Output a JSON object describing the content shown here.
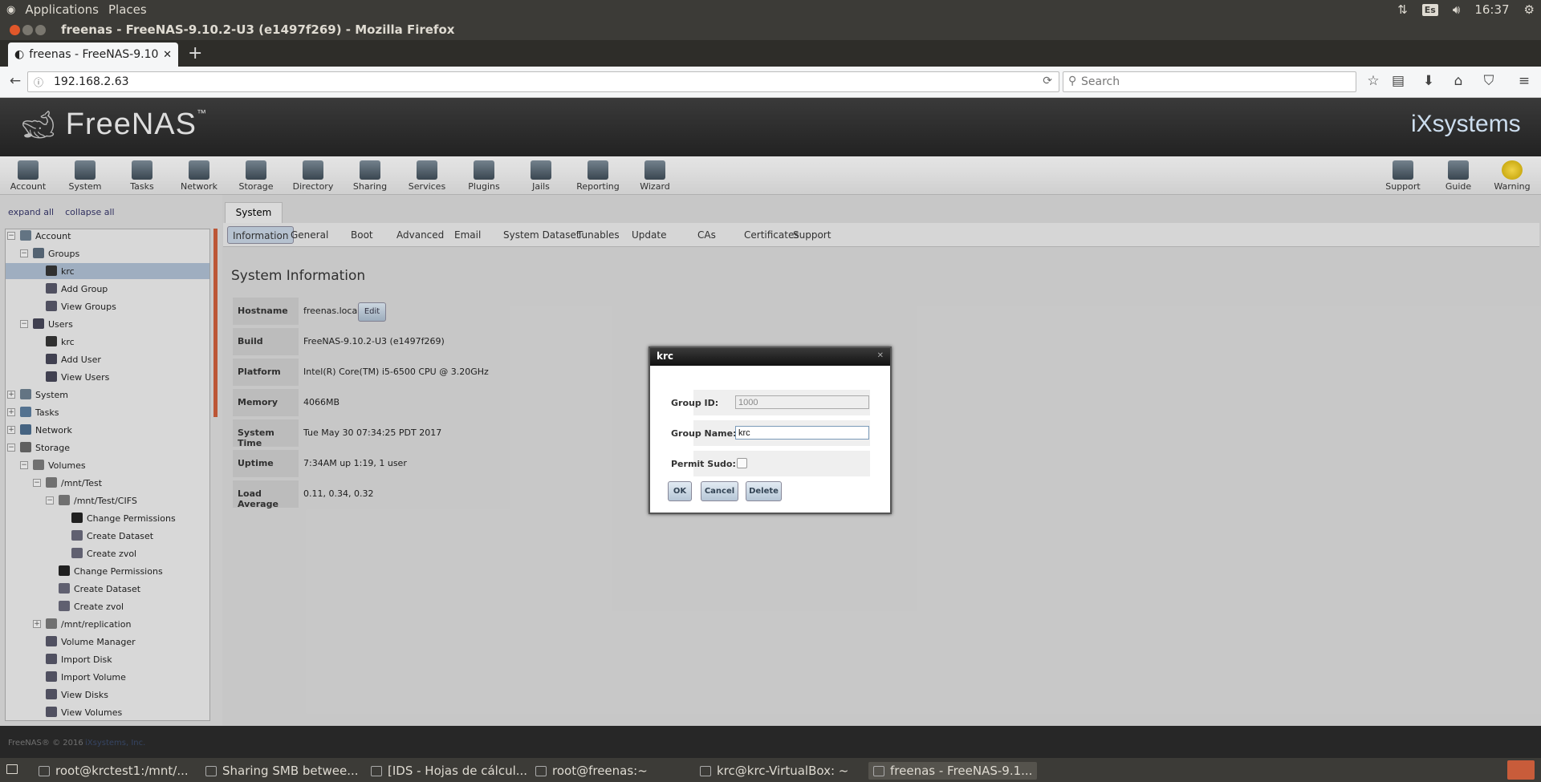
{
  "gnome": {
    "applications": "Applications",
    "places": "Places",
    "lang": "Es",
    "time": "16:37"
  },
  "window": {
    "title": "freenas - FreeNAS-9.10.2-U3 (e1497f269) - Mozilla Firefox"
  },
  "browser": {
    "tab_title": "freenas - FreeNAS-9.10",
    "url": "192.168.2.63",
    "search_placeholder": "Search"
  },
  "freenas": {
    "logo": "FreeNAS",
    "logo_tm": "™",
    "vendor": "iXsystems",
    "toolbar": [
      {
        "label": "Account"
      },
      {
        "label": "System"
      },
      {
        "label": "Tasks"
      },
      {
        "label": "Network"
      },
      {
        "label": "Storage"
      },
      {
        "label": "Directory"
      },
      {
        "label": "Sharing"
      },
      {
        "label": "Services"
      },
      {
        "label": "Plugins"
      },
      {
        "label": "Jails"
      },
      {
        "label": "Reporting"
      },
      {
        "label": "Wizard"
      }
    ],
    "toolbar_right": [
      {
        "label": "Support"
      },
      {
        "label": "Guide"
      },
      {
        "label": "Warning"
      }
    ],
    "tree_links": {
      "expand": "expand all",
      "collapse": "collapse all"
    },
    "tree": [
      {
        "label": "Account",
        "toggle": "−"
      },
      {
        "label": "Groups",
        "toggle": "−"
      },
      {
        "label": "krc",
        "selected": true
      },
      {
        "label": "Add Group"
      },
      {
        "label": "View Groups"
      },
      {
        "label": "Users",
        "toggle": "−"
      },
      {
        "label": "krc"
      },
      {
        "label": "Add User"
      },
      {
        "label": "View Users"
      },
      {
        "label": "System",
        "toggle": "+"
      },
      {
        "label": "Tasks",
        "toggle": "+"
      },
      {
        "label": "Network",
        "toggle": "+"
      },
      {
        "label": "Storage",
        "toggle": "−"
      },
      {
        "label": "Volumes",
        "toggle": "−"
      },
      {
        "label": "/mnt/Test",
        "toggle": "−"
      },
      {
        "label": "/mnt/Test/CIFS",
        "toggle": "−"
      },
      {
        "label": "Change Permissions"
      },
      {
        "label": "Create Dataset"
      },
      {
        "label": "Create zvol"
      },
      {
        "label": "Change Permissions"
      },
      {
        "label": "Create Dataset"
      },
      {
        "label": "Create zvol"
      },
      {
        "label": "/mnt/replication",
        "toggle": "+"
      },
      {
        "label": "Volume Manager"
      },
      {
        "label": "Import Disk"
      },
      {
        "label": "Import Volume"
      },
      {
        "label": "View Disks"
      },
      {
        "label": "View Volumes"
      }
    ],
    "main_tab": "System",
    "subtabs": [
      "Information",
      "General",
      "Boot",
      "Advanced",
      "Email",
      "System Dataset",
      "Tunables",
      "Update",
      "CAs",
      "Certificates",
      "Support"
    ],
    "info_title": "System Information",
    "info": [
      {
        "key": "Hostname",
        "value": "freenas.local"
      },
      {
        "key": "Build",
        "value": "FreeNAS-9.10.2-U3 (e1497f269)"
      },
      {
        "key": "Platform",
        "value": "Intel(R) Core(TM) i5-6500 CPU @ 3.20GHz"
      },
      {
        "key": "Memory",
        "value": "4066MB"
      },
      {
        "key": "System Time",
        "value": "Tue May 30 07:34:25 PDT 2017"
      },
      {
        "key": "Uptime",
        "value": "7:34AM up 1:19, 1 user"
      },
      {
        "key": "Load Average",
        "value": "0.11, 0.34, 0.32"
      }
    ],
    "edit_label": "Edit",
    "footer": "FreeNAS® © 2016",
    "footer_link": "iXsystems, Inc."
  },
  "modal": {
    "title": "krc",
    "group_id_label": "Group ID:",
    "group_id_value": "1000",
    "group_name_label": "Group Name:",
    "group_name_value": "krc",
    "permit_sudo_label": "Permit Sudo:",
    "ok": "OK",
    "cancel": "Cancel",
    "delete": "Delete"
  },
  "taskbar": [
    {
      "label": "root@krctest1:/mnt/..."
    },
    {
      "label": "Sharing SMB betwee..."
    },
    {
      "label": "[IDS - Hojas de cálcul..."
    },
    {
      "label": "root@freenas:~"
    },
    {
      "label": "krc@krc-VirtualBox: ~"
    },
    {
      "label": "freenas - FreeNAS-9.1...",
      "active": true
    }
  ],
  "colors": {
    "accent": "#a9b9cc",
    "header": "#2b2b2b",
    "scroll": "#c85c3a"
  }
}
